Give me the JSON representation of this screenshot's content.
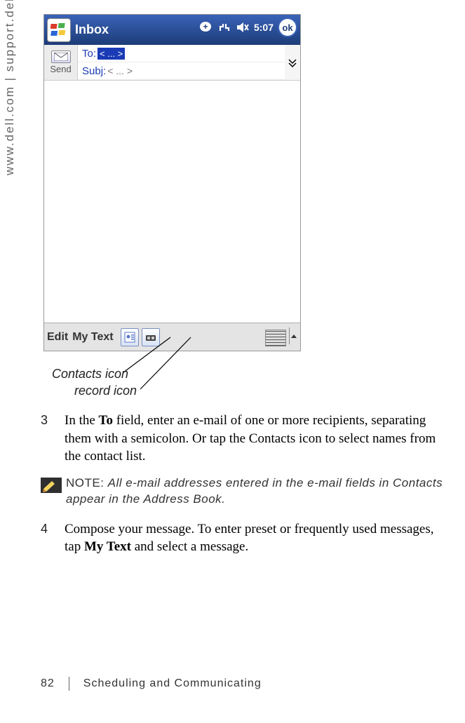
{
  "side_text": "www.dell.com | support.dell.com",
  "device": {
    "title": "Inbox",
    "clock": "5:07",
    "ok": "ok",
    "send": "Send",
    "to_label": "To:",
    "to_value": "< ... >",
    "subj_label": "Subj:",
    "subj_value": "< ... >",
    "bottom_menu1": "Edit",
    "bottom_menu2": "My Text"
  },
  "callouts": {
    "contacts": "Contacts icon",
    "record": "record icon"
  },
  "steps": {
    "s3_num": "3",
    "s3_pre": "In the ",
    "s3_bold": "To",
    "s3_post": " field, enter an e-mail of one or more recipients, separating them with a semicolon. Or tap the Contacts icon to select names from the contact list.",
    "note_label": "NOTE: ",
    "note_text": "All e-mail addresses entered in the e-mail fields in Contacts appear in the Address Book.",
    "s4_num": "4",
    "s4_pre": "Compose your message. To enter preset or frequently used messages, tap ",
    "s4_bold": "My Text",
    "s4_post": " and select a message."
  },
  "footer": {
    "page": "82",
    "chapter": "Scheduling and Communicating"
  }
}
